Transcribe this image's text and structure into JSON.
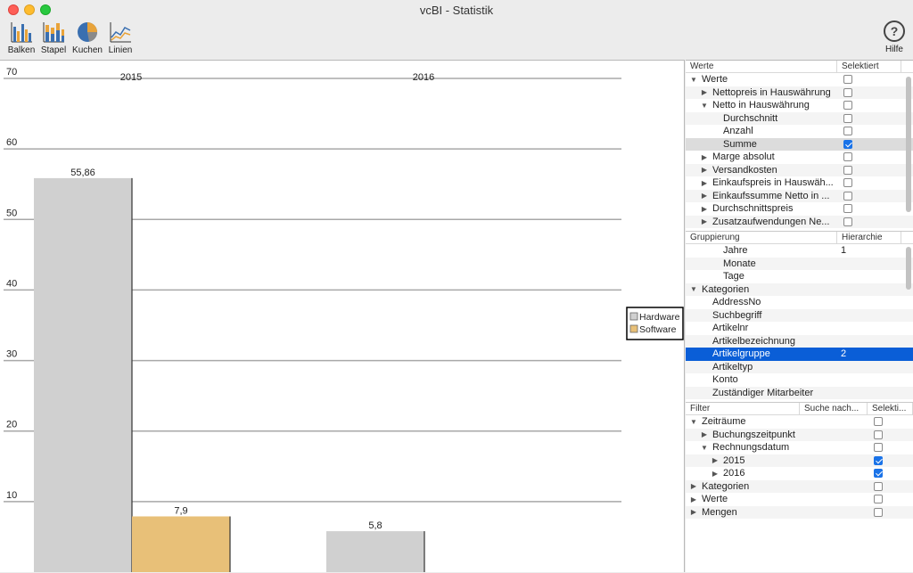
{
  "window": {
    "title": "vcBI - Statistik"
  },
  "toolbar": {
    "items": [
      {
        "label": "Balken",
        "icon": "bar-chart-icon"
      },
      {
        "label": "Stapel",
        "icon": "stacked-chart-icon"
      },
      {
        "label": "Kuchen",
        "icon": "pie-chart-icon"
      },
      {
        "label": "Linien",
        "icon": "line-chart-icon"
      }
    ],
    "help_label": "Hilfe"
  },
  "chart_data": {
    "type": "bar",
    "categories": [
      "2015",
      "2016"
    ],
    "series": [
      {
        "name": "Hardware",
        "color": "#d0d0d0",
        "values": [
          55.86,
          5.8
        ],
        "labels": [
          "55,86",
          "5,8"
        ]
      },
      {
        "name": "Software",
        "color": "#e8c078",
        "values": [
          7.9,
          null
        ],
        "labels": [
          "7,9",
          ""
        ]
      }
    ],
    "y_ticks": [
      "70",
      "60",
      "50",
      "40",
      "30",
      "20",
      "10"
    ],
    "ylim": [
      0,
      70
    ],
    "grid": true,
    "legend_position": "right"
  },
  "werte": {
    "col1": "Werte",
    "col2": "Selektiert",
    "rows": [
      {
        "label": "Werte",
        "level": 0,
        "tri": "▼",
        "checked": false
      },
      {
        "label": "Nettopreis in Hauswährung",
        "level": 1,
        "tri": "▶",
        "checked": false
      },
      {
        "label": "Netto in Hauswährung",
        "level": 1,
        "tri": "▼",
        "checked": false
      },
      {
        "label": "Durchschnitt",
        "level": 2,
        "tri": "",
        "checked": false
      },
      {
        "label": "Anzahl",
        "level": 2,
        "tri": "",
        "checked": false
      },
      {
        "label": "Summe",
        "level": 2,
        "tri": "",
        "checked": true,
        "highlight": true
      },
      {
        "label": "Marge absolut",
        "level": 1,
        "tri": "▶",
        "checked": false
      },
      {
        "label": "Versandkosten",
        "level": 1,
        "tri": "▶",
        "checked": false
      },
      {
        "label": "Einkaufspreis in Hauswäh...",
        "level": 1,
        "tri": "▶",
        "checked": false
      },
      {
        "label": "Einkaufssumme Netto in ...",
        "level": 1,
        "tri": "▶",
        "checked": false
      },
      {
        "label": "Durchschnittspreis",
        "level": 1,
        "tri": "▶",
        "checked": false
      },
      {
        "label": "Zusatzaufwendungen Ne...",
        "level": 1,
        "tri": "▶",
        "checked": false
      }
    ]
  },
  "gruppierung": {
    "col1": "Gruppierung",
    "col2": "Hierarchie",
    "rows": [
      {
        "label": "Jahre",
        "level": 2,
        "tri": "",
        "value": "1"
      },
      {
        "label": "Monate",
        "level": 2,
        "tri": "",
        "value": ""
      },
      {
        "label": "Tage",
        "level": 2,
        "tri": "",
        "value": ""
      },
      {
        "label": "Kategorien",
        "level": 0,
        "tri": "▼",
        "value": ""
      },
      {
        "label": "AddressNo",
        "level": 1,
        "tri": "",
        "value": ""
      },
      {
        "label": "Suchbegriff",
        "level": 1,
        "tri": "",
        "value": ""
      },
      {
        "label": "Artikelnr",
        "level": 1,
        "tri": "",
        "value": ""
      },
      {
        "label": "Artikelbezeichnung",
        "level": 1,
        "tri": "",
        "value": ""
      },
      {
        "label": "Artikelgruppe",
        "level": 1,
        "tri": "",
        "value": "2",
        "selected": true
      },
      {
        "label": "Artikeltyp",
        "level": 1,
        "tri": "",
        "value": ""
      },
      {
        "label": "Konto",
        "level": 1,
        "tri": "",
        "value": ""
      },
      {
        "label": "Zuständiger Mitarbeiter",
        "level": 1,
        "tri": "",
        "value": ""
      }
    ]
  },
  "filter": {
    "col1": "Filter",
    "col2": "Suche nach...",
    "col3": "Selekti...",
    "rows": [
      {
        "label": "Zeiträume",
        "level": 0,
        "tri": "▼",
        "checked": false
      },
      {
        "label": "Buchungszeitpunkt",
        "level": 1,
        "tri": "▶",
        "checked": false
      },
      {
        "label": "Rechnungsdatum",
        "level": 1,
        "tri": "▼",
        "checked": false
      },
      {
        "label": "2015",
        "level": 2,
        "tri": "▶",
        "checked": true
      },
      {
        "label": "2016",
        "level": 2,
        "tri": "▶",
        "checked": true
      },
      {
        "label": "Kategorien",
        "level": 0,
        "tri": "▶",
        "checked": false
      },
      {
        "label": "Werte",
        "level": 0,
        "tri": "▶",
        "checked": false
      },
      {
        "label": "Mengen",
        "level": 0,
        "tri": "▶",
        "checked": false
      }
    ]
  }
}
